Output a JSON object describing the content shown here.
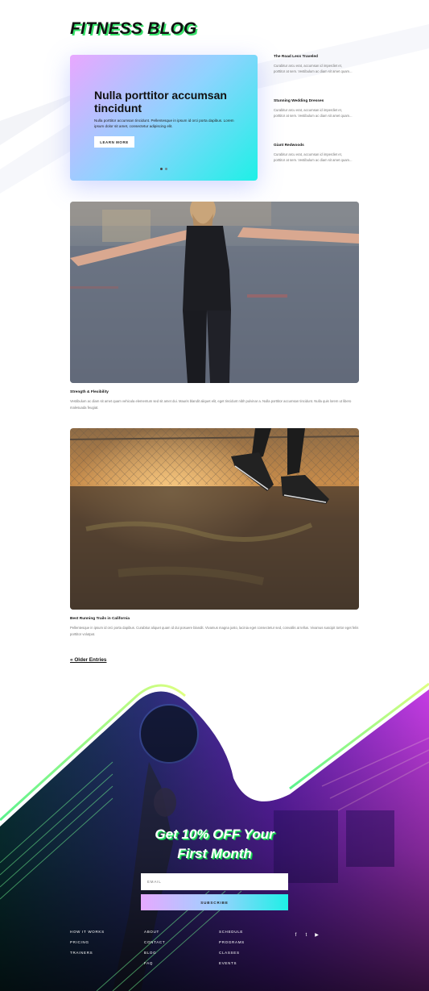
{
  "header": {
    "title": "FITNESS BLOG"
  },
  "slider": {
    "title": "Nulla porttitor accumsan tincidunt",
    "text": "Nulla porttitor accumsan tincidunt. Pellentesque in ipsum id orci porta dapibus. Lorem ipsum dolor sit amet, consectetur adipiscing elit.",
    "button_label": "LEARN MORE",
    "active_slide": 1,
    "slide_count": 2
  },
  "sidebar": {
    "posts": [
      {
        "title": "The Road Less Traveled",
        "excerpt": "Curabitur arcu erat, accumsan id imperdiet et, porttitor at sem. Vestibulum ac diam sit amet quam..."
      },
      {
        "title": "Stunning Wedding Dresses",
        "excerpt": "Curabitur arcu erat, accumsan id imperdiet et, porttitor at sem. Vestibulum ac diam sit amet quam..."
      },
      {
        "title": "Giant Redwoods",
        "excerpt": "Curabitur arcu erat, accumsan id imperdiet et, porttitor at sem. Vestibulum ac diam sit amet quam..."
      }
    ]
  },
  "posts": [
    {
      "title": "Strength & Flexibility",
      "excerpt": "Vestibulum ac diam sit amet quam vehicula elementum sed sit amet dui. Mauris blandit aliquet elit, eget tincidunt nibh pulvinar a. Nulla porttitor accumsan tincidunt. Nulla quis lorem ut libero malesuada feugiat."
    },
    {
      "title": "Best Running Trails in California",
      "excerpt": "Pellentesque in ipsum id orci porta dapibus. Curabitur aliquet quam id dui posuere blandit. Vivamus magna justo, lacinia eget consectetur sed, convallis at tellus. Vivamus suscipit tortor eget felis porttitor volutpat."
    }
  ],
  "pagination": {
    "older_label": "« Older Entries"
  },
  "newsletter": {
    "promo_line1": "Get 10% OFF Your",
    "promo_line2": "First Month",
    "email_placeholder": "EMAIL",
    "subscribe_label": "SUBSCRIBE"
  },
  "footer": {
    "columns": [
      [
        "HOW IT WORKS",
        "PRICING",
        "TRAINERS"
      ],
      [
        "ABOUT",
        "CONTACT",
        "BLOG",
        "FAQ"
      ],
      [
        "SCHEDULE",
        "PROGRAMS",
        "CLASSES",
        "EVENTS"
      ]
    ],
    "social": [
      {
        "icon": "facebook-icon",
        "glyph": "f"
      },
      {
        "icon": "twitter-icon",
        "glyph": "t"
      },
      {
        "icon": "youtube-icon",
        "glyph": "▶"
      }
    ]
  },
  "colors": {
    "accent_green": "#37e36b",
    "gradient_pink": "#e9a7ff",
    "gradient_cyan": "#1ef0e6",
    "footer_purple": "#8a2be2",
    "footer_magenta": "#e040fb"
  }
}
